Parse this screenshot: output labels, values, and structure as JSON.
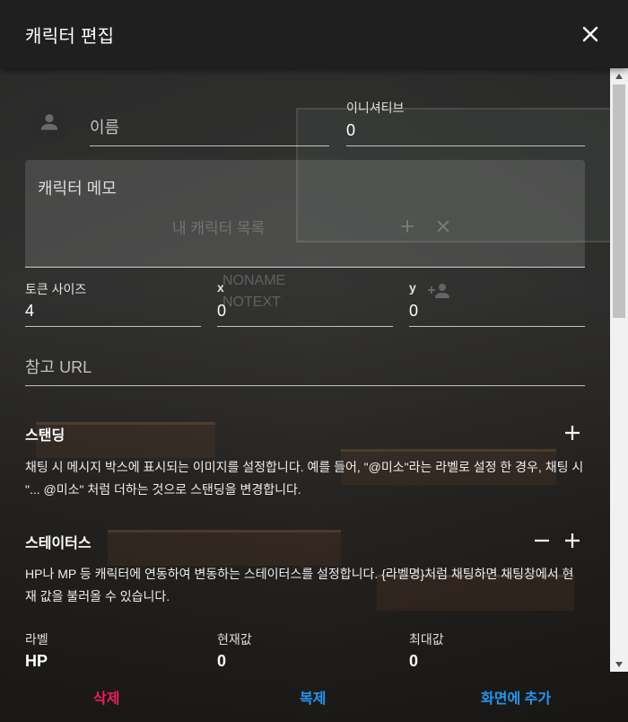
{
  "header": {
    "title": "캐릭터 편집"
  },
  "icons": {
    "close": "close-icon",
    "avatar": "person-icon",
    "add": "plus-icon",
    "remove": "minus-icon"
  },
  "form": {
    "name_placeholder": "이름",
    "initiative_label": "이니셔티브",
    "initiative_value": "0",
    "memo_placeholder": "캐릭터 메모",
    "token_size_label": "토큰 사이즈",
    "token_size_value": "4",
    "x_label": "x",
    "x_value": "0",
    "y_label": "y",
    "y_value": "0",
    "url_placeholder": "참고 URL"
  },
  "background_ghost": {
    "list_title": "내 캐릭터 목록",
    "noname": "NONAME",
    "notext": "NOTEXT"
  },
  "standing": {
    "title": "스탠딩",
    "description": "채팅 시 메시지 박스에 표시되는 이미지를 설정합니다. 예를 들어, \"@미소\"라는 라벨로 설정 한 경우, 채팅 시 \"... @미소\" 처럼 더하는 것으로 스탠딩을 변경합니다."
  },
  "status": {
    "title": "스테이터스",
    "description": "HP나 MP 등 캐릭터에 연동하여 변동하는 스테이터스를 설정합니다. {라벨명}처럼 채팅하면 채팅창에서 현재 값을 불러올 수 있습니다.",
    "columns": {
      "label": "라벨",
      "current": "현재값",
      "max": "최대값"
    },
    "rows": [
      {
        "label": "HP",
        "current": "0",
        "max": "0"
      }
    ]
  },
  "footer": {
    "delete": "삭제",
    "duplicate": "복제",
    "add_to_screen": "화면에 추가"
  },
  "colors": {
    "delete": "#e91e63",
    "action": "#2196f3",
    "header_bg": "#1f1f1f"
  }
}
